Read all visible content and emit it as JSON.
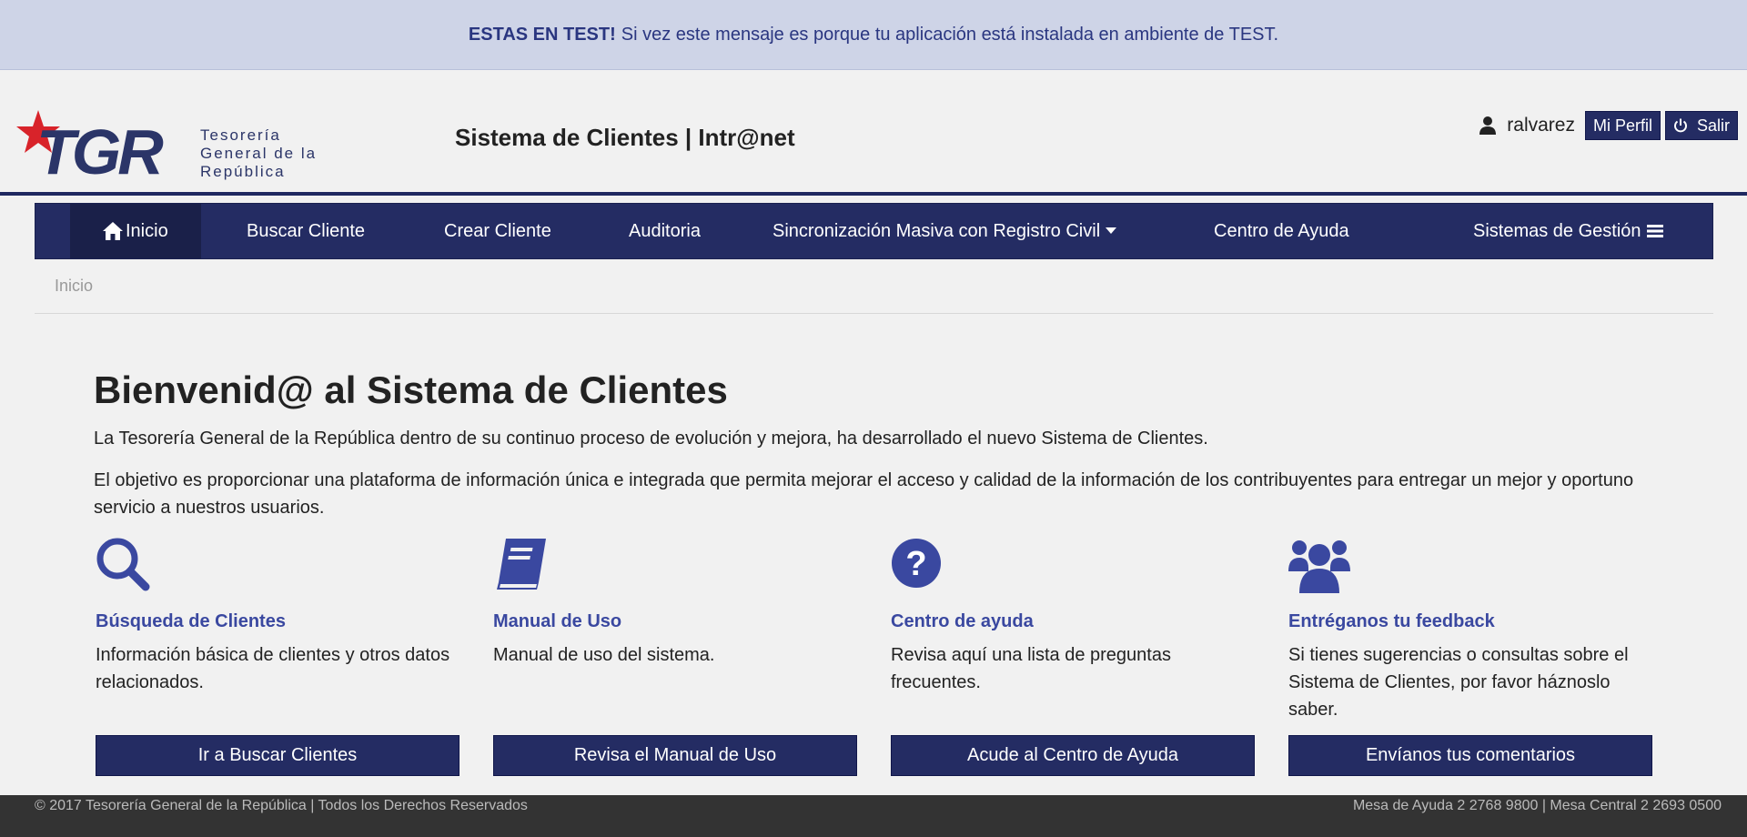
{
  "test_banner": {
    "strong": "ESTAS EN TEST!",
    "message": "Si vez este mensaje es porque tu aplicación está instalada en ambiente de TEST."
  },
  "header": {
    "logo_text": "TGR",
    "logo_subtitle": [
      "Tesorería",
      "General de la",
      "República"
    ],
    "system_title": "Sistema de Clientes | Intr@net",
    "username": "ralvarez",
    "profile_label": "Mi Perfil",
    "logout_label": "Salir"
  },
  "nav": {
    "home": "Inicio",
    "search_client": "Buscar Cliente",
    "create_client": "Crear Cliente",
    "audit": "Auditoria",
    "sync": "Sincronización Masiva con Registro Civil",
    "help_center": "Centro de Ayuda",
    "management": "Sistemas de Gestión"
  },
  "breadcrumb": "Inicio",
  "main": {
    "title": "Bienvenid@ al Sistema de Clientes",
    "intro1": "La Tesorería General de la República dentro de su continuo proceso de evolución y mejora, ha desarrollado el nuevo Sistema de Clientes.",
    "intro2": "El objetivo es proporcionar una plataforma de información única e integrada que permita mejorar el acceso y calidad de la información de los contribuyentes para entregar un mejor y oportuno servicio a nuestros usuarios."
  },
  "cards": [
    {
      "icon": "search-icon",
      "title": "Búsqueda de Clientes",
      "desc": "Información básica de clientes y otros datos relacionados.",
      "button": "Ir a Buscar Clientes"
    },
    {
      "icon": "book-icon",
      "title": "Manual de Uso",
      "desc": "Manual de uso del sistema.",
      "button": "Revisa el Manual de Uso"
    },
    {
      "icon": "question-circle-icon",
      "title": "Centro de ayuda",
      "desc": "Revisa aquí una lista de preguntas frecuentes.",
      "button": "Acude al Centro de Ayuda"
    },
    {
      "icon": "users-icon",
      "title": "Entréganos tu feedback",
      "desc": "Si tienes sugerencias o consultas sobre el Sistema de Clientes, por favor háznoslo saber.",
      "button": "Envíanos tus comentarios"
    }
  ],
  "footer": {
    "copyright": "© 2017 Tesorería General de la República | Todos los Derechos Reservados",
    "contact": "Mesa de Ayuda 2 2768 9800 | Mesa Central 2 2693 0500"
  },
  "colors": {
    "primary": "#242c63",
    "accent_text": "#3a48a0",
    "banner_bg": "#ced4e7",
    "logo_star": "#d8232a"
  }
}
